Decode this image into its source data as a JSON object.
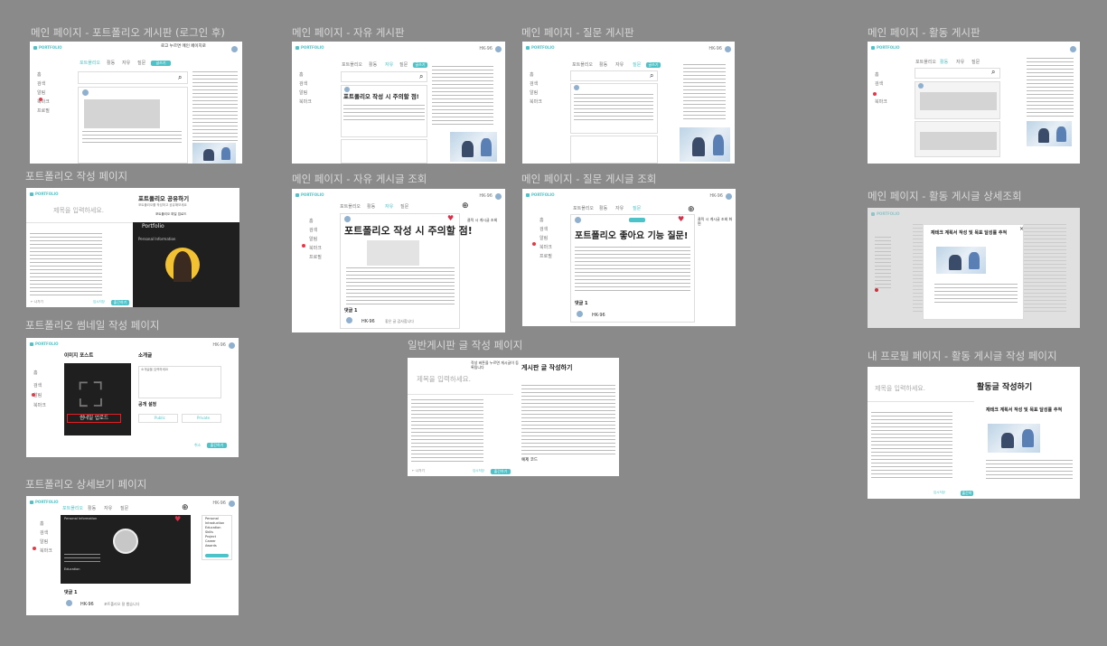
{
  "labels": {
    "main_portfolio": "메인 페이지 - 포트폴리오 게시판 (로그인 후)",
    "main_free": "메인 페이지 - 자유 게시판",
    "main_question": "메인 페이지 - 질문 게시판",
    "main_activity": "메인 페이지 - 활동 게시판",
    "portfolio_write": "포트폴리오 작성 페이지",
    "free_view": "메인 페이지 - 자유 게시글 조회",
    "question_view": "메인 페이지 - 질문 게시글 조회",
    "activity_detail": "메인 페이지 - 활동 게시글 상세조회",
    "thumbnail_write": "포트폴리오 썸네일 작성 페이지",
    "general_write": "일반게시판 글 작성 페이지",
    "my_profile_write": "내 프로필 페이지 - 활동 게시글 작성 페이지",
    "portfolio_detail": "포트폴리오 상세보기 페이지"
  },
  "notes": {
    "portfolio_main": "로고 누르면 메인 페이지로",
    "free_view": "클릭 시 게시글 조회",
    "question_view": "클릭 시 게시글 조회 화면",
    "general_write": "작성 버튼을 누르면 게시글이 등록됩니다"
  },
  "common": {
    "logo": "PORTFOLIO",
    "user": "HK-96",
    "write_btn": "글쓰기",
    "tabs": [
      "포트폴리오",
      "활동",
      "자유",
      "질문"
    ],
    "side_items": [
      "홈",
      "검색",
      "알림",
      "북마크",
      "프로필"
    ]
  },
  "posts": {
    "free_title": "포트폴리오 작성 시 주의할 점!",
    "question_title": "포트폴리오 좋아요 기능 질문!",
    "activity_title": "재테크 계획서 작성 및 목표 달성률 추적",
    "comment_label": "댓글 1",
    "comment_text": "좋은 글 감사합니다"
  },
  "portfolio_write": {
    "title_placeholder": "제목을 입력하세요.",
    "heading": "포트폴리오 공유하기",
    "sub": "포트폴리오를 작성하고 공유해보세요",
    "upload_btn": "포트폴리오 파일 업로드",
    "preview_title": "Portfolio",
    "preview_section": "Personal Information",
    "exit": "← 나가기",
    "save": "임시저장",
    "publish": "출간하기"
  },
  "thumbnail": {
    "image_label": "이미지 포스트",
    "intro_label": "소개글",
    "intro_placeholder": "소개글을 입력하세요",
    "upload_btn": "썸네일 업로드",
    "visibility": "공개 설정",
    "public": "Public",
    "private": "Private",
    "cancel": "취소",
    "publish": "출간하기"
  },
  "general_write": {
    "title_placeholder": "제목을 입력하세요.",
    "heading": "게시판 글 작성하기",
    "exit": "← 나가기",
    "save": "임시저장",
    "publish": "출간하기",
    "example": "예제 코드"
  },
  "activity_write": {
    "title_placeholder": "제목을 입력하세요.",
    "heading": "활동글 작성하기",
    "save": "임시저장",
    "publish": "출간하기"
  },
  "detail": {
    "section": "Personal Information",
    "education": "Education",
    "menu": [
      "Personal",
      "Introduction",
      "Education",
      "Skills",
      "Project",
      "Career",
      "Awards"
    ],
    "comment_label": "댓글 1",
    "comment_text": "포트폴리오 잘 봤습니다"
  }
}
